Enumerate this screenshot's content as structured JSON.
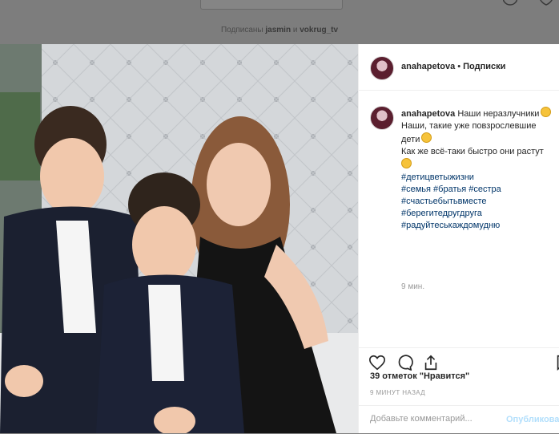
{
  "background": {
    "followers_prefix": "Подписаны",
    "followers_user1": "jasmin",
    "followers_and": "и",
    "followers_user2": "vokrug_tv"
  },
  "post": {
    "username": "anahapetova",
    "follow_label": "Подписки",
    "caption_text": "Наши неразлучники",
    "caption_lines": [
      "Наши, такие уже повзрослевшие",
      "дети",
      "Как же всё-таки быстро они растут"
    ],
    "hashtags": [
      "#детицветыжизни",
      "#семья #братья #сестра",
      "#счастьебытьвместе",
      "#берегитедругдруга",
      "#радуйтеськаждомудню"
    ],
    "time": "9 мин.",
    "likes": "39 отметок \"Нравится\"",
    "posted_ago": "9 МИНУТ НАЗАД",
    "comment_placeholder": "Добавьте комментарий...",
    "publish_label": "Опубликовать"
  },
  "icons": [
    "heart-icon",
    "comment-icon",
    "share-icon",
    "bookmark-icon",
    "compass-icon"
  ],
  "colors": {
    "link": "#003569",
    "muted": "#999999",
    "publish": "#b2dffc",
    "text": "#262626"
  }
}
